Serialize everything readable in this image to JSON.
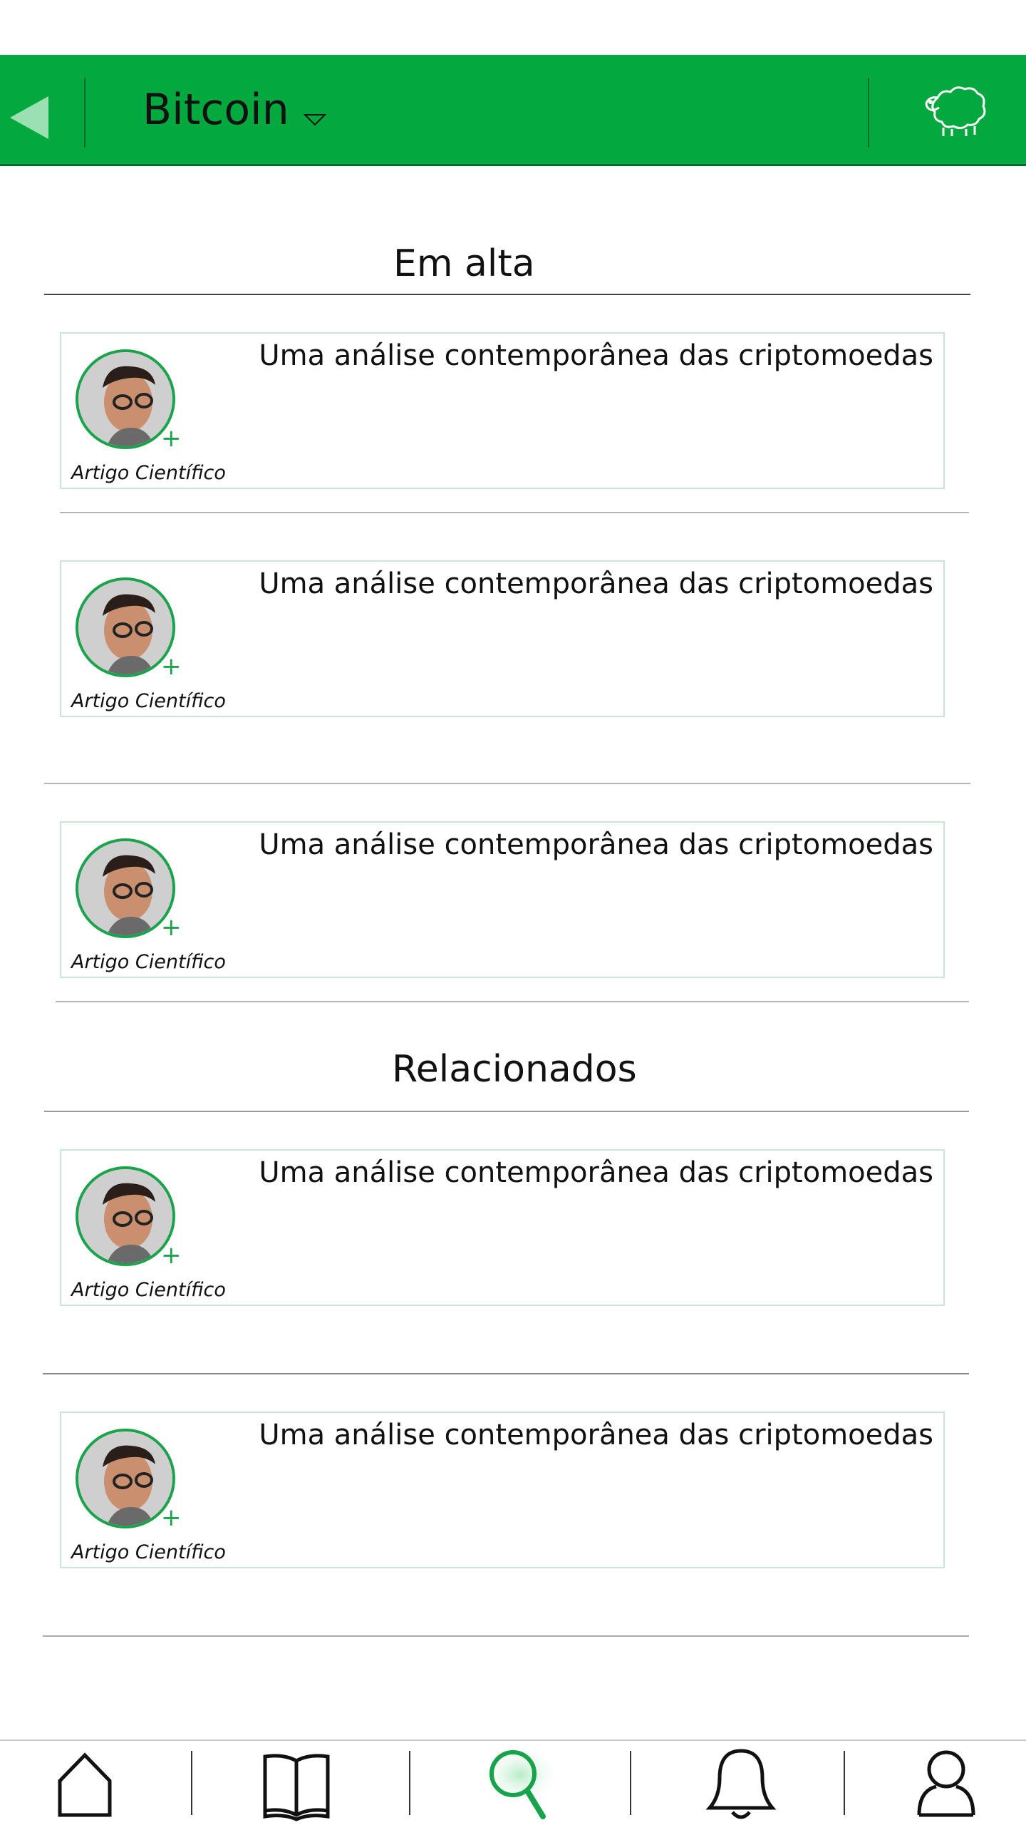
{
  "header": {
    "title": "Bitcoin",
    "back_icon": "back-triangle-icon",
    "dropdown_icon": "caret-down-icon",
    "mascot_icon": "sheep-icon",
    "colors": {
      "bar": "#03a83e",
      "back": "#9be0b2",
      "mascot": "#ffffff"
    }
  },
  "sections": [
    {
      "title": "Em alta"
    },
    {
      "title": "Relacionados"
    }
  ],
  "cards": [
    {
      "title": "Uma análise contemporânea das criptomoedas",
      "type": "Artigo Científico",
      "action": "+"
    },
    {
      "title": "Uma análise contemporânea das criptomoedas",
      "type": "Artigo Científico",
      "action": "+"
    },
    {
      "title": "Uma análise contemporânea das criptomoedas",
      "type": "Artigo Científico",
      "action": "+"
    },
    {
      "title": "Uma análise contemporânea das criptomoedas",
      "type": "Artigo Científico",
      "action": "+"
    },
    {
      "title": "Uma análise contemporânea das criptomoedas",
      "type": "Artigo Científico",
      "action": "+"
    }
  ],
  "bottom_nav": {
    "items": [
      {
        "icon": "home-icon",
        "active": false
      },
      {
        "icon": "book-icon",
        "active": false
      },
      {
        "icon": "search-icon",
        "active": true
      },
      {
        "icon": "bell-icon",
        "active": false
      },
      {
        "icon": "profile-icon",
        "active": false
      }
    ],
    "active_color": "#16a34a"
  }
}
